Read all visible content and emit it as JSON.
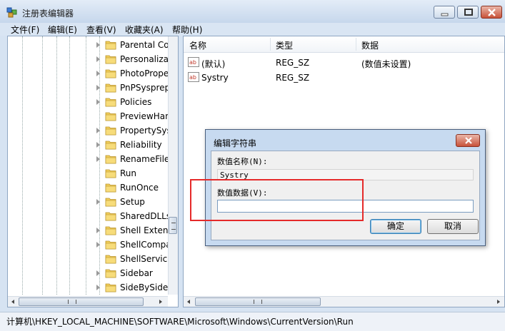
{
  "window": {
    "title": "注册表编辑器"
  },
  "menu": [
    "文件(F)",
    "编辑(E)",
    "查看(V)",
    "收藏夹(A)",
    "帮助(H)"
  ],
  "tree": {
    "items": [
      {
        "label": "Parental Co",
        "expandable": true
      },
      {
        "label": "Personaliza",
        "expandable": true
      },
      {
        "label": "PhotoPrope",
        "expandable": true
      },
      {
        "label": "PnPSysprep",
        "expandable": true
      },
      {
        "label": "Policies",
        "expandable": true
      },
      {
        "label": "PreviewHan",
        "expandable": false
      },
      {
        "label": "PropertySys",
        "expandable": true
      },
      {
        "label": "Reliability",
        "expandable": true
      },
      {
        "label": "RenameFile",
        "expandable": true
      },
      {
        "label": "Run",
        "expandable": false,
        "selected": true
      },
      {
        "label": "RunOnce",
        "expandable": false
      },
      {
        "label": "Setup",
        "expandable": true
      },
      {
        "label": "SharedDLLs",
        "expandable": false
      },
      {
        "label": "Shell Extens",
        "expandable": true
      },
      {
        "label": "ShellCompa",
        "expandable": true
      },
      {
        "label": "ShellService",
        "expandable": false
      },
      {
        "label": "Sidebar",
        "expandable": true
      },
      {
        "label": "SideBySide",
        "expandable": true
      }
    ]
  },
  "list": {
    "columns": [
      "名称",
      "类型",
      "数据"
    ],
    "rows": [
      {
        "name": "(默认)",
        "type": "REG_SZ",
        "data": "(数值未设置)"
      },
      {
        "name": "Systry",
        "type": "REG_SZ",
        "data": ""
      }
    ]
  },
  "status": {
    "path": "计算机\\HKEY_LOCAL_MACHINE\\SOFTWARE\\Microsoft\\Windows\\CurrentVersion\\Run"
  },
  "dialog": {
    "title": "编辑字符串",
    "name_label": "数值名称(N):",
    "name_value": "Systry",
    "data_label": "数值数据(V):",
    "data_value": "",
    "ok_label": "确定",
    "cancel_label": "取消"
  },
  "colors": {
    "highlight_box": "#e52a2a"
  }
}
